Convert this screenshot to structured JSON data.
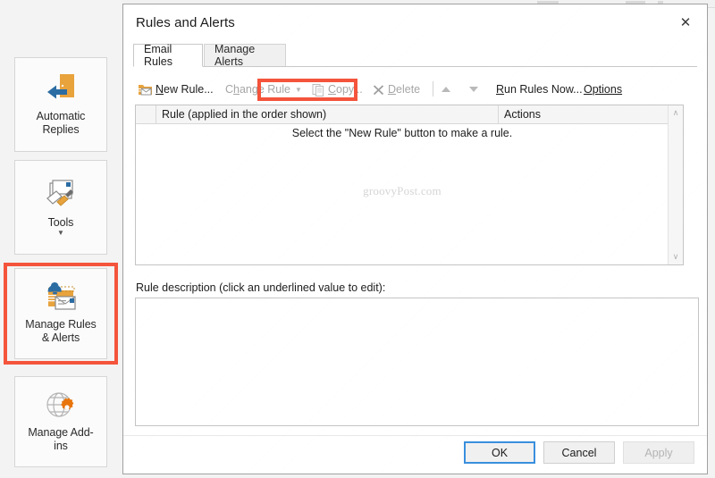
{
  "sidebar": {
    "items": [
      {
        "label": "Automatic\nReplies",
        "line1": "Automatic",
        "line2": "Replies",
        "icon": "automatic-replies-icon",
        "has_caret": false,
        "highlighted": false
      },
      {
        "label": "Tools",
        "line1": "Tools",
        "line2": "",
        "icon": "tools-icon",
        "has_caret": true,
        "highlighted": false
      },
      {
        "label": "Manage Rules & Alerts",
        "line1": "Manage Rules",
        "line2": "& Alerts",
        "icon": "manage-rules-alerts-icon",
        "has_caret": false,
        "highlighted": true
      },
      {
        "label": "Manage Add-ins",
        "line1": "Manage Add-",
        "line2": "ins",
        "icon": "manage-addins-icon",
        "has_caret": false,
        "highlighted": false
      }
    ]
  },
  "dialog": {
    "title": "Rules and Alerts",
    "close_label": "✕",
    "tabs": [
      {
        "label": "Email Rules",
        "active": true
      },
      {
        "label": "Manage Alerts",
        "active": false
      }
    ],
    "toolbar": {
      "new_rule": {
        "pre": "",
        "accel": "N",
        "post": "ew Rule...",
        "icon": "new-rule-folder-icon",
        "enabled": true
      },
      "change_rule": {
        "pre": "C",
        "accel": "h",
        "post": "ange Rule",
        "icon": "chevron-down-icon",
        "enabled": false
      },
      "copy": {
        "pre": "",
        "accel": "C",
        "post": "opy...",
        "icon": "copy-pages-icon",
        "enabled": false
      },
      "delete": {
        "pre": "",
        "accel": "D",
        "post": "elete",
        "icon": "delete-x-icon",
        "enabled": false
      },
      "move_up": {
        "label": "Move Up",
        "icon": "triangle-up-icon",
        "enabled": false
      },
      "move_down": {
        "label": "Move Down",
        "icon": "triangle-down-icon",
        "enabled": false
      },
      "run_rules_now": {
        "pre": "",
        "accel": "R",
        "post": "un Rules Now...",
        "enabled": true
      },
      "options": {
        "pre": "",
        "accel": "O",
        "post": "ptions",
        "enabled": true
      }
    },
    "rules_list": {
      "columns": [
        {
          "key": "check",
          "label": ""
        },
        {
          "key": "rule",
          "label": "Rule (applied in the order shown)"
        },
        {
          "key": "actions",
          "label": "Actions"
        }
      ],
      "rows": [],
      "empty_message": "Select the \"New Rule\" button to make a rule.",
      "watermark": "groovyPost.com",
      "scrollbar": {
        "up": "∧",
        "down": "∨"
      }
    },
    "description": {
      "label": "Rule description (click an underlined value to edit):",
      "value": ""
    },
    "footer": {
      "ok": {
        "label": "OK",
        "state": "default-focused"
      },
      "cancel": {
        "label": "Cancel",
        "state": "enabled"
      },
      "apply": {
        "label": "Apply",
        "state": "disabled"
      }
    }
  },
  "colors": {
    "highlight_red": "#f4543c",
    "accent_orange": "#e8a33d",
    "focus_blue": "#3a8fdd",
    "bell_blue": "#2b6ca3"
  }
}
